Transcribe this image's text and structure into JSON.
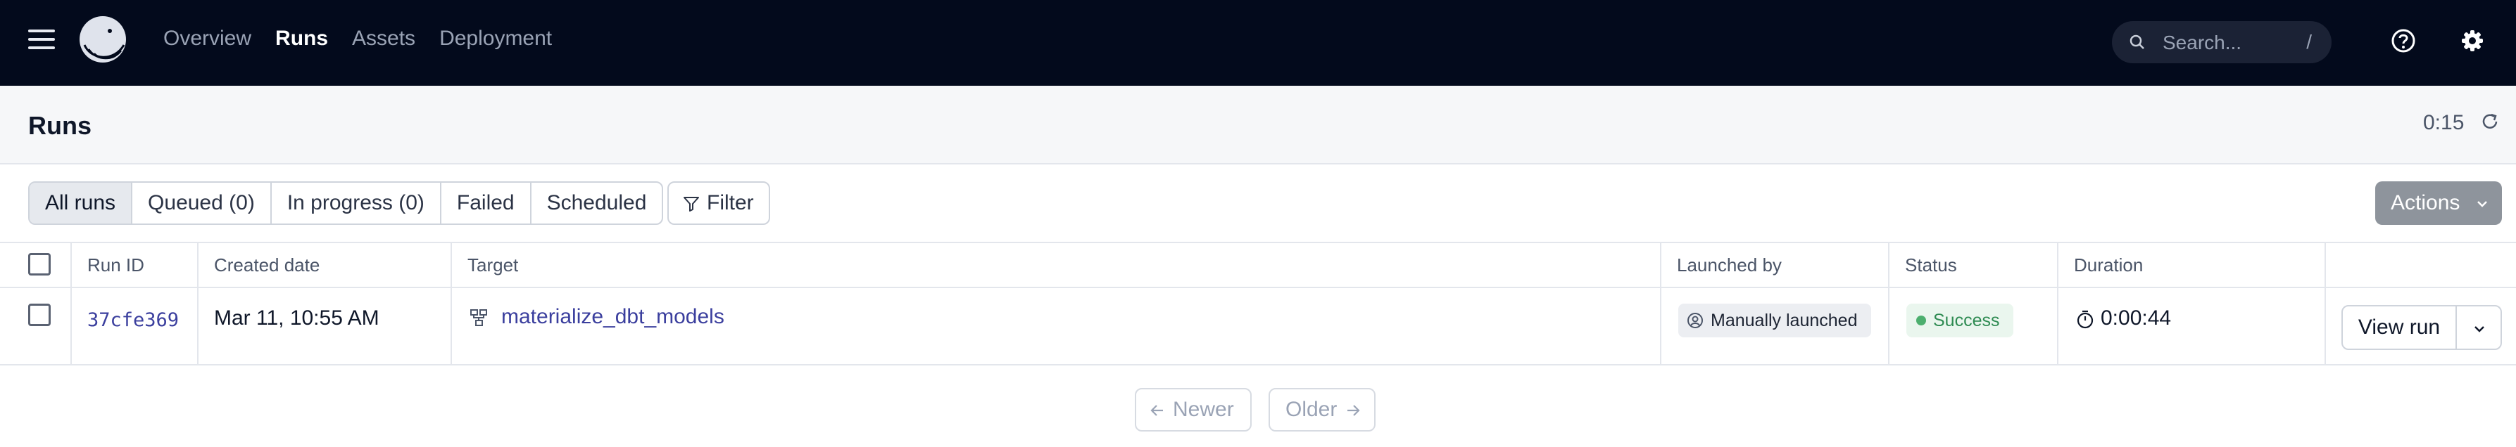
{
  "nav": {
    "links": [
      "Overview",
      "Runs",
      "Assets",
      "Deployment"
    ],
    "active": "Runs",
    "search_placeholder": "Search...",
    "search_shortcut": "/"
  },
  "page": {
    "title": "Runs",
    "refresh_timer": "0:15"
  },
  "filters": {
    "tabs": [
      "All runs",
      "Queued (0)",
      "In progress (0)",
      "Failed",
      "Scheduled"
    ],
    "active_tab": "All runs",
    "filter_label": "Filter",
    "actions_label": "Actions"
  },
  "table": {
    "columns": [
      "Run ID",
      "Created date",
      "Target",
      "Launched by",
      "Status",
      "Duration"
    ],
    "rows": [
      {
        "run_id": "37cfe369",
        "created": "Mar 11, 10:55 AM",
        "target": "materialize_dbt_models",
        "launched_by": "Manually launched",
        "status": "Success",
        "duration": "0:00:44",
        "action": "View run"
      }
    ]
  },
  "pagination": {
    "newer": "Newer",
    "older": "Older"
  },
  "colors": {
    "nav_bg": "#030a1c",
    "link": "#3b3f9e",
    "success": "#2e8b52",
    "actions_bg": "#8e949c"
  }
}
